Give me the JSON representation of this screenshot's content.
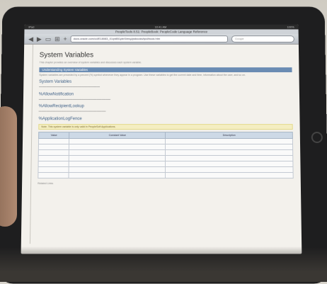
{
  "device": {
    "status_left": "iPad",
    "status_time": "10:41 AM",
    "status_right": "100%"
  },
  "browser": {
    "window_title": "PeopleTools 8.51: PeopleBook: PeopleCode Language Reference",
    "url": "docs.oracle.com/cd/E18083_01/pt851pbr0/eng/psbooks/tpcl/book.htm",
    "search_placeholder": "Google"
  },
  "page": {
    "title": "System Variables",
    "intro": "This chapter provides an overview of system variables and discusses each system variable.",
    "section_header": "Understanding System Variables",
    "section_text": "System variables are preceded by a percent (%) symbol whenever they appear in a program. Use these variables to get the current date and time, information about the user, and so on.",
    "headings": [
      "System Variables",
      "%AllowNotification",
      "%AllowRecipientLookup",
      "%ApplicationLogFence"
    ],
    "note": "Note. This system variable is only valid in PeopleSoft Applications.",
    "table_headers": [
      "Value",
      "Constant Value",
      "Description"
    ],
    "table_rows": 7,
    "footer": "Related Links"
  }
}
